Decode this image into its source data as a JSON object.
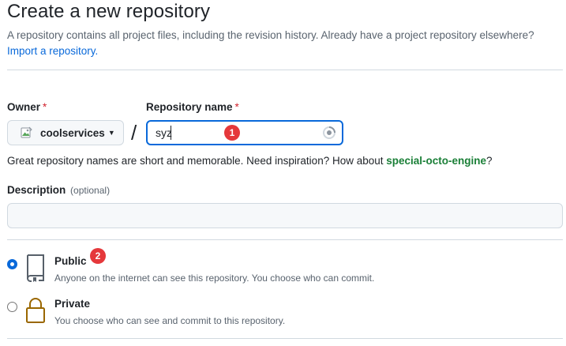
{
  "page": {
    "title": "Create a new repository",
    "subtitle": "A repository contains all project files, including the revision history. Already have a project repository elsewhere?",
    "import_link": "Import a repository."
  },
  "owner": {
    "label": "Owner",
    "required_mark": "*",
    "value": "coolservices",
    "avatar_icon": "broken-image-icon",
    "caret_icon": "triangle-down-icon"
  },
  "repo": {
    "separator": "/",
    "label": "Repository name",
    "required_mark": "*",
    "value": "syz",
    "status_icon": "loading-spinner-icon",
    "annotation_badge": "1"
  },
  "hint": {
    "text": "Great repository names are short and memorable. Need inspiration? How about ",
    "suggestion": "special-octo-engine",
    "suffix": "?"
  },
  "description": {
    "label": "Description",
    "optional": "(optional)",
    "value": ""
  },
  "visibility": {
    "options": [
      {
        "title": "Public",
        "description": "Anyone on the internet can see this repository. You choose who can commit.",
        "icon": "repo-book-icon",
        "selected": true,
        "annotation_badge": "2"
      },
      {
        "title": "Private",
        "description": "You choose who can see and commit to this repository.",
        "icon": "lock-icon",
        "selected": false
      }
    ]
  },
  "colors": {
    "accent": "#0969da",
    "suggestion": "#1a7f37",
    "required": "#d1242f",
    "badge": "#e5383b",
    "lock": "#9a6700"
  }
}
